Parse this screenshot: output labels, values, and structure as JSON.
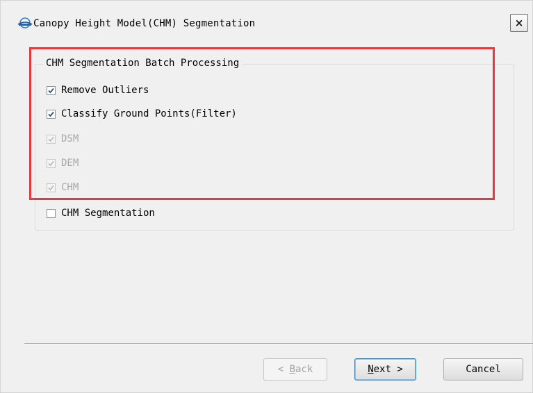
{
  "window": {
    "title": "Canopy Height Model(CHM) Segmentation",
    "close_label": "×"
  },
  "group": {
    "title": "CHM Segmentation Batch Processing",
    "items": [
      {
        "label": "Remove Outliers",
        "checked": true,
        "enabled": true
      },
      {
        "label": "Classify Ground Points(Filter)",
        "checked": true,
        "enabled": true
      },
      {
        "label": "DSM",
        "checked": true,
        "enabled": false
      },
      {
        "label": "DEM",
        "checked": true,
        "enabled": false
      },
      {
        "label": "CHM",
        "checked": true,
        "enabled": false
      },
      {
        "label": "CHM Segmentation",
        "checked": false,
        "enabled": true
      }
    ]
  },
  "buttons": {
    "back": {
      "arrow": "<",
      "mnemonic": "B",
      "rest": "ack",
      "enabled": false
    },
    "next": {
      "mnemonic": "N",
      "rest": "ext",
      "arrow": ">",
      "enabled": true
    },
    "cancel": {
      "label": "Cancel",
      "enabled": true
    }
  },
  "colors": {
    "highlight": "#e13a3f",
    "check": "#2b4f8f",
    "disabled_text": "#a8a8a8"
  },
  "icons": {
    "app": "app-logo-icon",
    "close": "close-icon",
    "check": "checkmark-icon"
  }
}
